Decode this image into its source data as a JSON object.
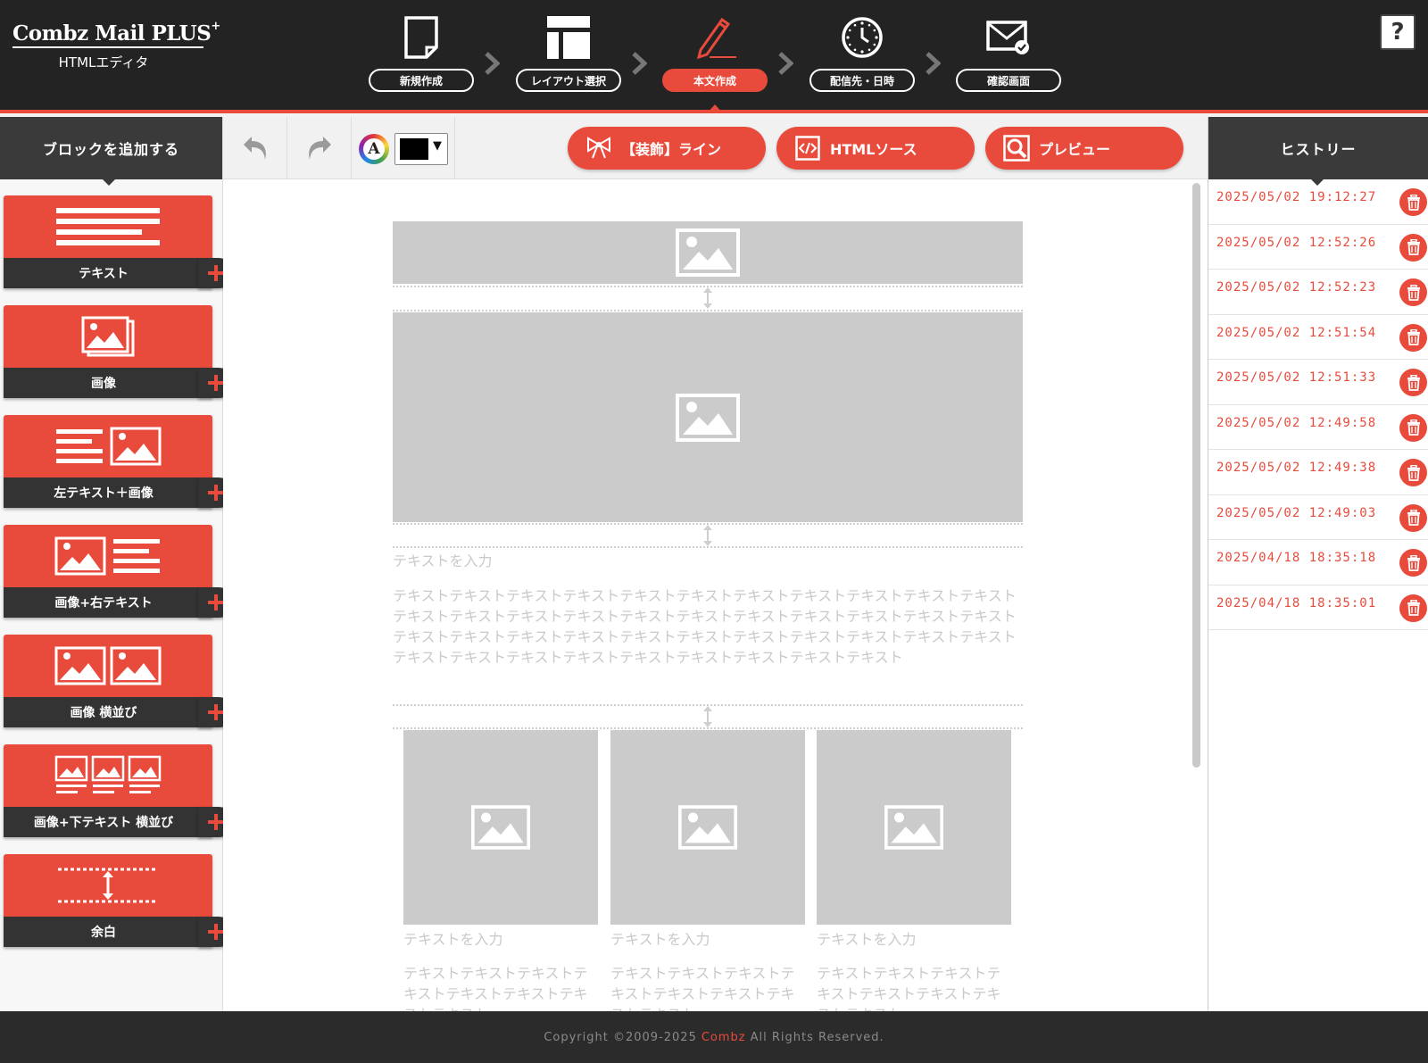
{
  "app": {
    "logo_main": "Combz Mail PLUS",
    "logo_sup": "+",
    "logo_sub": "HTMLエディタ"
  },
  "steps": [
    {
      "label": "新規作成",
      "icon": "new-document-icon",
      "active": false
    },
    {
      "label": "レイアウト選択",
      "icon": "layout-icon",
      "active": false
    },
    {
      "label": "本文作成",
      "icon": "pencil-icon",
      "active": true
    },
    {
      "label": "配信先・日時",
      "icon": "clock-icon",
      "active": false
    },
    {
      "label": "確認画面",
      "icon": "mail-check-icon",
      "active": false
    }
  ],
  "help_label": "?",
  "left_sidebar": {
    "title": "ブロックを追加する",
    "blocks": [
      {
        "label": "テキスト",
        "icon": "text-lines-icon"
      },
      {
        "label": "画像",
        "icon": "image-stack-icon"
      },
      {
        "label": "左テキスト＋画像",
        "icon": "text-image-icon"
      },
      {
        "label": "画像+右テキスト",
        "icon": "image-text-icon"
      },
      {
        "label": "画像 横並び",
        "icon": "two-images-icon"
      },
      {
        "label": "画像+下テキスト 横並び",
        "icon": "three-images-text-icon"
      },
      {
        "label": "余白",
        "icon": "spacer-icon"
      }
    ]
  },
  "toolbar": {
    "undo_icon": "undo-icon",
    "redo_icon": "redo-icon",
    "color_letter": "A",
    "color_value": "#000000",
    "caret": "▼",
    "buttons": [
      {
        "label": "【装飾】ライン",
        "icon": "ribbon-icon"
      },
      {
        "label": "HTMLソース",
        "icon": "code-icon"
      },
      {
        "label": "プレビュー",
        "icon": "magnifier-icon"
      }
    ]
  },
  "canvas": {
    "heading_placeholder": "テキストを入力",
    "body_placeholder": "テキストテキストテキストテキストテキストテキストテキストテキストテキストテキストテキストテキストテキストテキストテキストテキストテキストテキストテキストテキストテキストテキストテキストテキストテキストテキストテキストテキストテキストテキストテキストテキストテキストテキストテキストテキストテキストテキストテキストテキストテキストテキスト",
    "columns": [
      {
        "heading": "テキストを入力",
        "body": "テキストテキストテキストテキストテキストテキストテキストテキスト"
      },
      {
        "heading": "テキストを入力",
        "body": "テキストテキストテキストテキストテキストテキストテキストテキスト"
      },
      {
        "heading": "テキストを入力",
        "body": "テキストテキストテキストテキストテキストテキストテキストテキスト"
      }
    ]
  },
  "history": {
    "title": "ヒストリー",
    "items": [
      "2025/05/02 19:12:27",
      "2025/05/02 12:52:26",
      "2025/05/02 12:52:23",
      "2025/05/02 12:51:54",
      "2025/05/02 12:51:33",
      "2025/05/02 12:49:58",
      "2025/05/02 12:49:38",
      "2025/05/02 12:49:03",
      "2025/04/18 18:35:18",
      "2025/04/18 18:35:01"
    ]
  },
  "footer": {
    "prefix": "Copyright ©2009-2025",
    "brand": "Combz",
    "suffix": "All Rights Reserved."
  },
  "colors": {
    "accent": "#e84b3c",
    "header_bg": "#232323",
    "panel_dark": "#3a3a3a",
    "placeholder": "#cbcbcb"
  }
}
